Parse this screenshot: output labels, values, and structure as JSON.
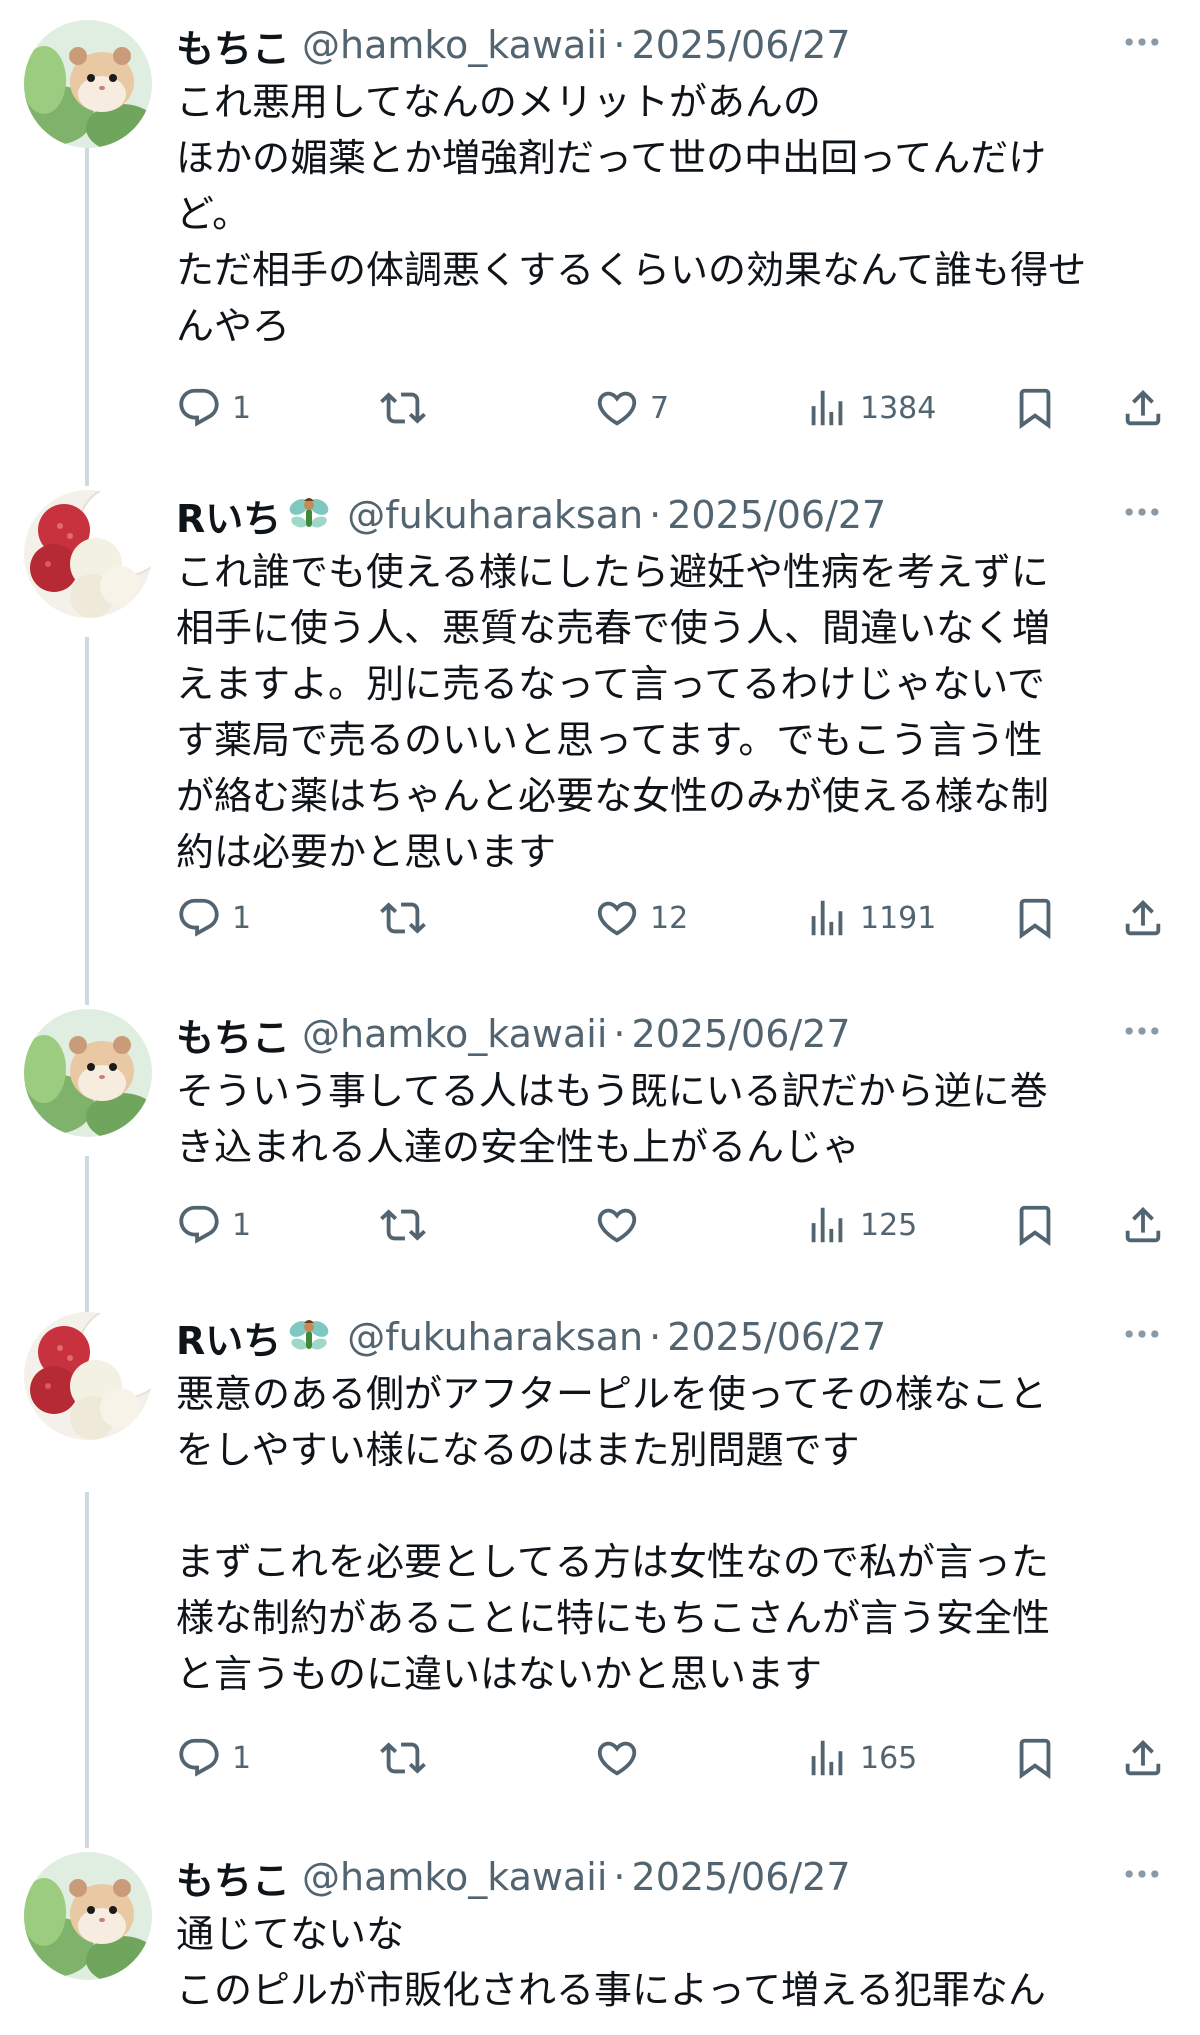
{
  "replies": [
    {
      "name": "もちこ",
      "handle": "@hamko_kawaii",
      "sep": "·",
      "date": "2025/06/27",
      "avatar": "hamster-avatar",
      "text": "これ悪用してなんのメリットがあんの\nほかの媚薬とか増強剤だって世の中出回ってんだけ\nど。\nただ相手の体調悪くするくらいの効果なんて誰も得せ\nんやろ",
      "reply_count": "1",
      "retweet_count": "",
      "like_count": "7",
      "view_count": "1384"
    },
    {
      "name": "Rいち",
      "badge": "fairy-emoji",
      "handle": "@fukuharaksan",
      "sep": "·",
      "date": "2025/06/27",
      "avatar": "lychee-avatar",
      "text": "これ誰でも使える様にしたら避妊や性病を考えずに\n相手に使う人、悪質な売春で使う人、間違いなく増\nえますよ。別に売るなって言ってるわけじゃないで\nす薬局で売るのいいと思ってます。でもこう言う性\nが絡む薬はちゃんと必要な女性のみが使える様な制\n約は必要かと思います",
      "reply_count": "1",
      "retweet_count": "",
      "like_count": "12",
      "view_count": "1191"
    },
    {
      "name": "もちこ",
      "handle": "@hamko_kawaii",
      "sep": "·",
      "date": "2025/06/27",
      "avatar": "hamster-avatar",
      "text": "そういう事してる人はもう既にいる訳だから逆に巻\nき込まれる人達の安全性も上がるんじゃ",
      "reply_count": "1",
      "retweet_count": "",
      "like_count": "",
      "view_count": "125"
    },
    {
      "name": "Rいち",
      "badge": "fairy-emoji",
      "handle": "@fukuharaksan",
      "sep": "·",
      "date": "2025/06/27",
      "avatar": "lychee-avatar",
      "text": "悪意のある側がアフターピルを使ってその様なこと\nをしやすい様になるのはまた別問題です\n\nまずこれを必要としてる方は女性なので私が言った\n様な制約があることに特にもちこさんが言う安全性\nと言うものに違いはないかと思います",
      "reply_count": "1",
      "retweet_count": "",
      "like_count": "",
      "view_count": "165"
    },
    {
      "name": "もちこ",
      "handle": "@hamko_kawaii",
      "sep": "·",
      "date": "2025/06/27",
      "avatar": "hamster-avatar",
      "text": "通じてないな\nこのピルが市販化される事によって増える犯罪なん"
    }
  ]
}
